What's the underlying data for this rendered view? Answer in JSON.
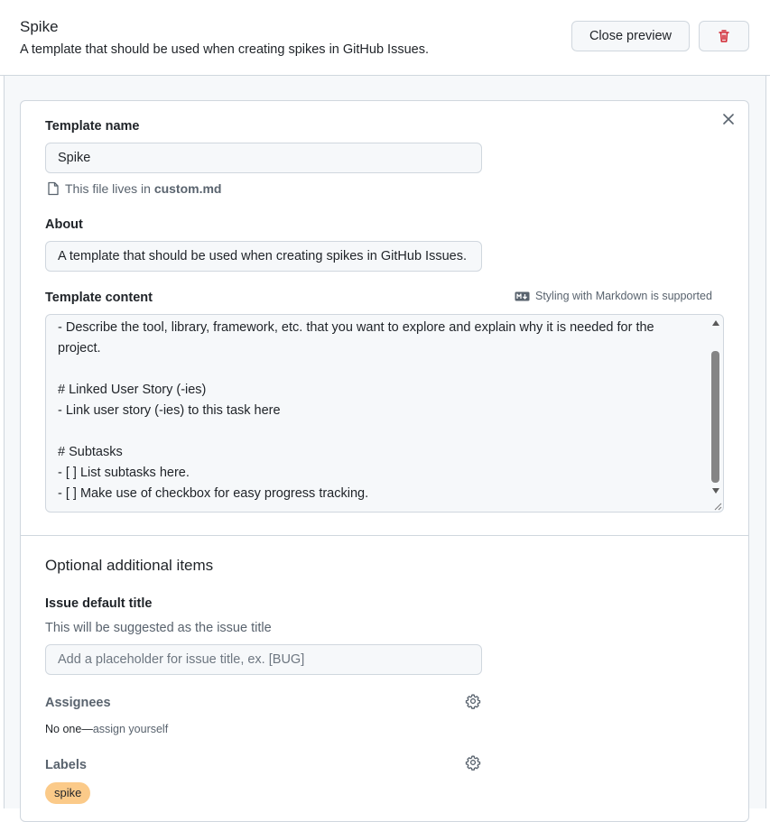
{
  "header": {
    "title": "Spike",
    "subtitle": "A template that should be used when creating spikes in GitHub Issues.",
    "close_preview_label": "Close preview"
  },
  "form": {
    "template_name_label": "Template name",
    "template_name_value": "Spike",
    "file_note_prefix": "This file lives in",
    "file_name": "custom.md",
    "about_label": "About",
    "about_value": "A template that should be used when creating spikes in GitHub Issues.",
    "content_label": "Template content",
    "markdown_note": "Styling with Markdown is supported",
    "content_lines": [
      "- Describe the tool, library, framework, etc. that you want to explore and explain why it is needed for the",
      "project.",
      "",
      "# Linked User Story (-ies)",
      "- Link user story (-ies) to this task here",
      "",
      "# Subtasks",
      "- [ ] List subtasks here.",
      "- [ ] Make use of checkbox for easy progress tracking."
    ]
  },
  "optional": {
    "section_title": "Optional additional items",
    "issue_title_label": "Issue default title",
    "issue_title_help": "This will be suggested as the issue title",
    "issue_title_placeholder": "Add a placeholder for issue title, ex. [BUG]",
    "assignees_label": "Assignees",
    "assignees_none": "No one",
    "assignees_separator": "—",
    "assign_yourself": "assign yourself",
    "labels_label": "Labels",
    "label_chip": "spike"
  },
  "colors": {
    "label_chip": "#fbca89",
    "danger": "#d1242f",
    "border": "#d0d7de"
  },
  "icons": {
    "delete": "trash-icon",
    "close": "x-icon",
    "file": "file-icon",
    "markdown": "markdown-icon",
    "settings": "gear-icon"
  }
}
